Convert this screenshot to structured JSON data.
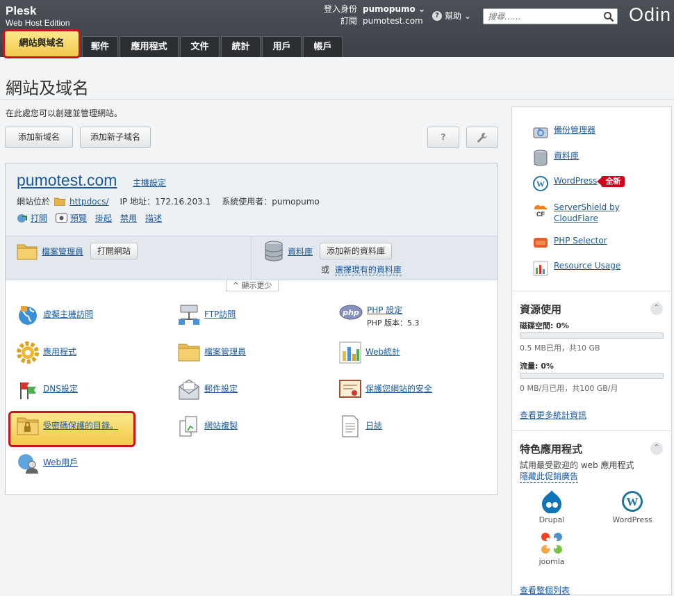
{
  "brand": {
    "name": "Plesk",
    "edition": "Web Host Edition"
  },
  "header": {
    "login_label": "登入身份",
    "login_user": "pumopumo",
    "subscription_label": "訂閱",
    "subscription_value": "pumotest.com",
    "help_label": "幫助",
    "search_placeholder": "搜尋……",
    "vendor_logo": "Odin"
  },
  "tabs": [
    {
      "label": "網站與域名",
      "active": true
    },
    {
      "label": "郵件"
    },
    {
      "label": "應用程式"
    },
    {
      "label": "文件"
    },
    {
      "label": "統計"
    },
    {
      "label": "用戶"
    },
    {
      "label": "帳戶"
    }
  ],
  "page": {
    "title": "網站及域名",
    "intro": "在此處您可以創建並管理網站。",
    "add_domain_button": "添加新域名",
    "add_subdomain_button": "添加新子域名",
    "help_button": "?"
  },
  "domain": {
    "name": "pumotest.com",
    "host_settings": "主機設定",
    "location_label": "網站位於",
    "docroot": "httpdocs/",
    "ip_label": "IP 地址：172.16.203.1",
    "sysuser_label": "系統使用者：pumopumo",
    "actions": [
      "打開",
      "預覽",
      "掛起",
      "禁用",
      "描述"
    ],
    "file_manager": "檔案管理員",
    "open_site_button": "打開網站",
    "databases": "資料庫",
    "add_db_button": "添加新的資料庫",
    "or_label": "或",
    "select_db": "選擇現有的資料庫",
    "show_less": "顯示更少"
  },
  "features": [
    {
      "label": "虛擬主機訪問"
    },
    {
      "label": "FTP訪問"
    },
    {
      "label": "PHP 設定",
      "sub": "PHP 版本：5.3"
    },
    {
      "label": "應用程式"
    },
    {
      "label": "檔案管理員"
    },
    {
      "label": "Web統計"
    },
    {
      "label": "DNS設定"
    },
    {
      "label": "郵件設定"
    },
    {
      "label": "保護您網站的安全"
    },
    {
      "label": "受密碼保護的目錄。"
    },
    {
      "label": "網站複製"
    },
    {
      "label": "日誌"
    },
    {
      "label": "Web用戶"
    }
  ],
  "sidebar": {
    "links": [
      {
        "label": "備份管理器"
      },
      {
        "label": "資料庫"
      },
      {
        "label": "WordPress",
        "badge": "全新"
      },
      {
        "label": "ServerShield by CloudFlare"
      },
      {
        "label": "PHP Selector"
      },
      {
        "label": "Resource Usage"
      }
    ],
    "resources": {
      "title": "資源使用",
      "disk_label": "磁碟空間: 0%",
      "disk_used": "0.5 MB已用，共10 GB",
      "disk_fraction": 0.0,
      "traffic_label": "流量: 0%",
      "traffic_used": "0 MB/月已用，共100 GB/月",
      "traffic_fraction": 0.0,
      "more_stats": "查看更多統計資訊"
    },
    "featured": {
      "title": "特色應用程式",
      "subtitle": "試用最受歡迎的 web 應用程式",
      "hide": "隱藏此促銷廣告",
      "apps": [
        "Drupal",
        "WordPress",
        "joomla"
      ],
      "view_all": "查看整個列表"
    }
  },
  "colors": {
    "header_bg": "#3c4147",
    "active_tab": "#f2c94c",
    "highlight_border": "#c8161d",
    "link": "#1a5aa0"
  }
}
